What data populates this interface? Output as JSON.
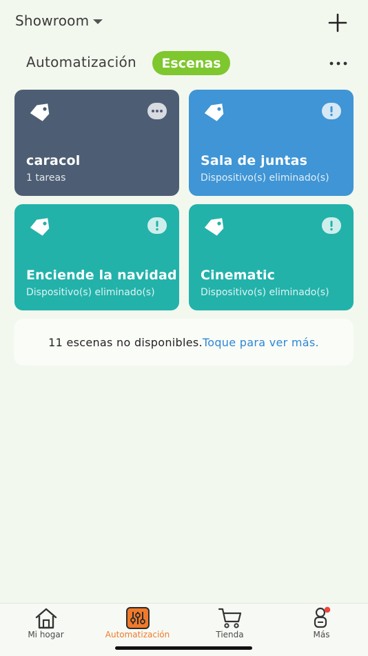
{
  "header": {
    "home_name": "Showroom"
  },
  "tabs": {
    "automation_label": "Automatización",
    "scenes_label": "Escenas"
  },
  "scenes": [
    {
      "title": "caracol",
      "subtitle": "1 tareas",
      "color": "#4d5e74",
      "badge_icon": "more-icon"
    },
    {
      "title": "Sala de juntas",
      "subtitle": "Dispositivo(s) eliminado(s)",
      "color": "#3f95d5",
      "badge_icon": "warning-icon"
    },
    {
      "title": "Enciende la navidad",
      "subtitle": "Dispositivo(s) eliminado(s)",
      "color": "#22b2aa",
      "badge_icon": "warning-icon"
    },
    {
      "title": "Cinematic",
      "subtitle": "Dispositivo(s) eliminado(s)",
      "color": "#22b2aa",
      "badge_icon": "warning-icon"
    }
  ],
  "banner": {
    "text": "11 escenas no disponibles.",
    "link": "Toque para ver más."
  },
  "nav": {
    "items": [
      {
        "label": "Mi hogar",
        "icon": "home-icon"
      },
      {
        "label": "Automatización",
        "icon": "automation-icon"
      },
      {
        "label": "Tienda",
        "icon": "cart-icon"
      },
      {
        "label": "Más",
        "icon": "profile-icon"
      }
    ],
    "active_color": "#f07a2a"
  },
  "colors": {
    "accent_green": "#7ec72e",
    "link_blue": "#2c86d6",
    "background": "#f3f8ee"
  }
}
